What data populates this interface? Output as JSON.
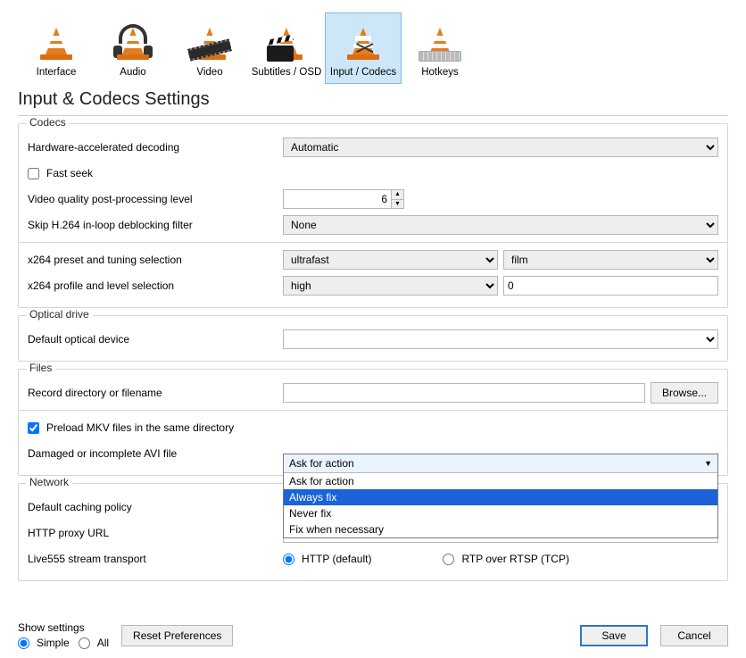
{
  "categories": {
    "interface": "Interface",
    "audio": "Audio",
    "video": "Video",
    "subtitles": "Subtitles / OSD",
    "input": "Input / Codecs",
    "hotkeys": "Hotkeys"
  },
  "page_title": "Input & Codecs Settings",
  "groups": {
    "codecs": {
      "title": "Codecs",
      "hw_decoding_label": "Hardware-accelerated decoding",
      "hw_decoding_value": "Automatic",
      "fast_seek": "Fast seek",
      "video_quality_label": "Video quality post-processing level",
      "video_quality_value": "6",
      "skip_deblock_label": "Skip H.264 in-loop deblocking filter",
      "skip_deblock_value": "None",
      "x264_preset_label": "x264 preset and tuning selection",
      "x264_preset_value": "ultrafast",
      "x264_tuning_value": "film",
      "x264_profile_label": "x264 profile and level selection",
      "x264_profile_value": "high",
      "x264_level_value": "0"
    },
    "optical": {
      "title": "Optical drive",
      "default_optical_label": "Default optical device",
      "default_optical_value": ""
    },
    "files": {
      "title": "Files",
      "record_dir_label": "Record directory or filename",
      "record_dir_value": "",
      "browse": "Browse...",
      "preload_mkv": "Preload MKV files in the same directory",
      "damaged_avi_label": "Damaged or incomplete AVI file",
      "damaged_avi_value": "Ask for action",
      "damaged_avi_options": [
        "Ask for action",
        "Always fix",
        "Never fix",
        "Fix when necessary"
      ],
      "damaged_avi_highlighted": "Always fix"
    },
    "network": {
      "title": "Network",
      "caching_label": "Default caching policy",
      "caching_value": "",
      "http_proxy_label": "HTTP proxy URL",
      "http_proxy_value": "",
      "live555_label": "Live555 stream transport",
      "live555_http": "HTTP (default)",
      "live555_rtp": "RTP over RTSP (TCP)"
    }
  },
  "footer": {
    "show_settings": "Show settings",
    "simple": "Simple",
    "all": "All",
    "reset": "Reset Preferences",
    "save": "Save",
    "cancel": "Cancel"
  }
}
